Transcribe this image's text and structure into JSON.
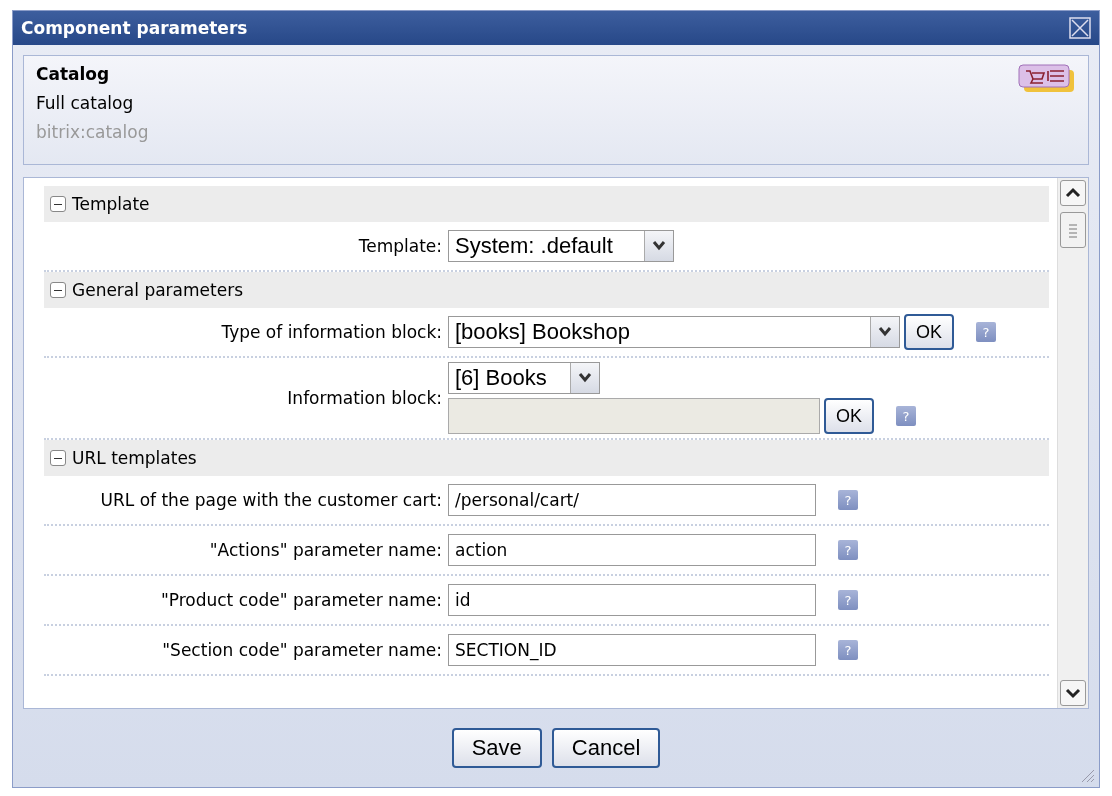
{
  "window": {
    "title": "Component parameters"
  },
  "component": {
    "name": "Catalog",
    "description": "Full catalog",
    "id": "bitrix:catalog"
  },
  "sections": [
    {
      "title": "Template",
      "expanded": true,
      "params": [
        {
          "kind": "select",
          "label": "Template:",
          "value": "System: .default"
        }
      ]
    },
    {
      "title": "General parameters",
      "expanded": true,
      "params": [
        {
          "kind": "select_ok",
          "label": "Type of information block:",
          "value": "[books] Bookshop",
          "button": "OK",
          "help": "?"
        },
        {
          "kind": "select_field_ok",
          "label": "Information block:",
          "value": "[6] Books",
          "button": "OK",
          "help": "?"
        }
      ]
    },
    {
      "title": "URL templates",
      "expanded": true,
      "params": [
        {
          "kind": "text",
          "label": "URL of the page with the customer cart:",
          "value": "/personal/cart/",
          "help": "?"
        },
        {
          "kind": "text",
          "label": "\"Actions\" parameter name:",
          "value": "action",
          "help": "?"
        },
        {
          "kind": "text",
          "label": "\"Product code\" parameter name:",
          "value": "id",
          "help": "?"
        },
        {
          "kind": "text",
          "label": "\"Section code\" parameter name:",
          "value": "SECTION_ID",
          "help": "?"
        }
      ]
    }
  ],
  "buttons": [
    "Save",
    "Cancel"
  ]
}
